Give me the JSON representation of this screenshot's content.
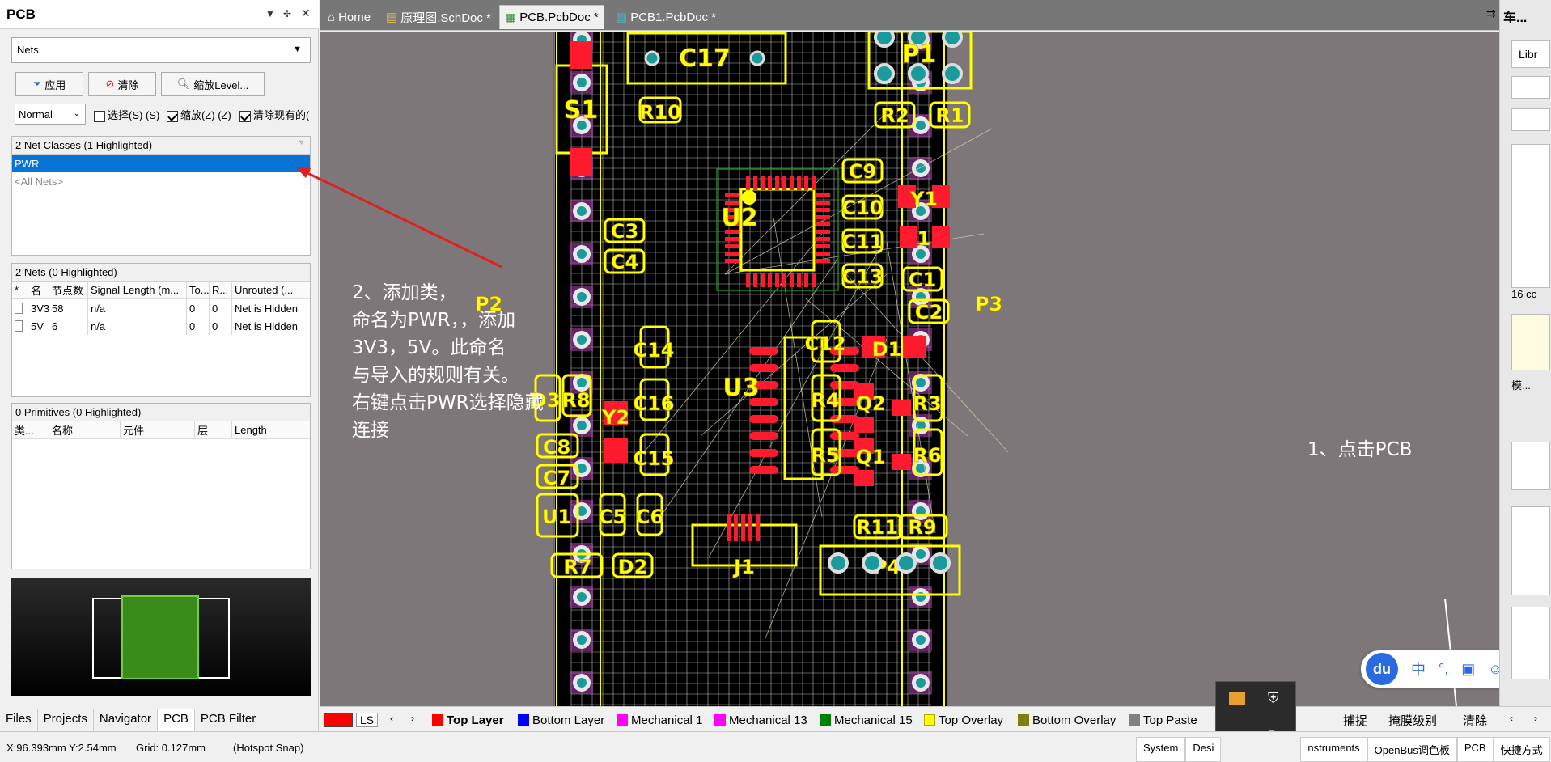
{
  "panel": {
    "title": "PCB",
    "mode": "Nets",
    "apply_label": "应用",
    "clear_label": "清除",
    "zoom_label": "缩放Level...",
    "mask_mode": "Normal",
    "select_label": "选择(S) (S)",
    "zoom_check_label": "缩放(Z) (Z)",
    "clear_existing_label": "清除现有的(",
    "net_classes_header": "2 Net Classes (1 Highlighted)",
    "net_classes": [
      "PWR",
      "<All Nets>"
    ],
    "nets_header": "2 Nets (0 Highlighted)",
    "nets_columns": [
      "*",
      "名",
      "节点数",
      "Signal Length (m...",
      "To...",
      "R...",
      "Unrouted (..."
    ],
    "nets": [
      {
        "name": "3V3",
        "nodes": "58",
        "length": "n/a",
        "to": "0",
        "r": "0",
        "unrouted": "Net is Hidden"
      },
      {
        "name": "5V",
        "nodes": "6",
        "length": "n/a",
        "to": "0",
        "r": "0",
        "unrouted": "Net is Hidden"
      }
    ],
    "primitives_header": "0 Primitives (0 Highlighted)",
    "primitives_columns": [
      "类...",
      "名称",
      "元件",
      "层",
      "Length"
    ],
    "bottom_tabs": [
      "Files",
      "Projects",
      "Navigator",
      "PCB",
      "PCB Filter"
    ]
  },
  "tabs": [
    {
      "label": "Home",
      "active": false
    },
    {
      "label": "原理图.SchDoc *",
      "active": false
    },
    {
      "label": "PCB.PcbDoc *",
      "active": true
    },
    {
      "label": "PCB1.PcbDoc *",
      "active": false
    }
  ],
  "tab_extra": "车...",
  "annotation_left": [
    "2、添加类，",
    "命名为PWR，，添加",
    "3V3，5V。此命名",
    "与导入的规则有关。",
    "右键点击PWR选择隐藏",
    "连接"
  ],
  "annotation_right": "1、点击PCB",
  "components": {
    "C17": "C17",
    "P1": "P1",
    "S1": "S1",
    "R10": "R10",
    "R2": "R2",
    "R1": "R1",
    "C9": "C9",
    "Y1": "Y1",
    "U2": "U2",
    "C10": "C10",
    "C3": "C3",
    "C11": "C11",
    "I": "1",
    "C4": "C4",
    "C13": "C13",
    "C1": "C1",
    "C2": "C2",
    "P2": "P2",
    "P3": "P3",
    "C14": "C14",
    "C12": "C12",
    "D1": "D1",
    "U3": "U3",
    "D3": "D3",
    "R8": "R8",
    "C16": "C16",
    "R4": "R4",
    "Q2": "Q2",
    "R3": "R3",
    "Y2": "Y2",
    "C8": "C8",
    "R5": "R5",
    "Q1": "Q1",
    "R6": "R6",
    "C15": "C15",
    "C7": "C7",
    "U1": "U1",
    "C5": "C5",
    "C6": "C6",
    "R11": "R11",
    "R9": "R9",
    "R7": "R7",
    "D2": "D2",
    "J1": "J1",
    "P4": "P4"
  },
  "layers": [
    {
      "name": "LS",
      "color": "#ff0000"
    },
    {
      "name": "Top Layer",
      "color": "#ff0000",
      "bold": true
    },
    {
      "name": "Bottom Layer",
      "color": "#0000ff"
    },
    {
      "name": "Mechanical 1",
      "color": "#ff00ff"
    },
    {
      "name": "Mechanical 13",
      "color": "#ff00ff"
    },
    {
      "name": "Mechanical 15",
      "color": "#008000"
    },
    {
      "name": "Top Overlay",
      "color": "#ffff00"
    },
    {
      "name": "Bottom Overlay",
      "color": "#808000"
    },
    {
      "name": "Top Paste",
      "color": "#808080"
    }
  ],
  "layer_actions": [
    "捕捉",
    "掩膜级别",
    "清除"
  ],
  "status": {
    "coords": "X:96.393mm Y:2.54mm",
    "grid": "Grid: 0.127mm",
    "snap": "(Hotspot Snap)",
    "right_items": [
      "System",
      "Desi",
      "nstruments",
      "OpenBus调色板",
      "PCB",
      "快捷方式"
    ]
  },
  "right_panel": {
    "lib": "Libr",
    "size": "16 cc",
    "mode": "模..."
  },
  "colors": {
    "board": "#000000",
    "overlay": "#ffff00",
    "pad": "#ff1a2e",
    "grid": "#ffffff",
    "canvas": "#7e7779"
  }
}
